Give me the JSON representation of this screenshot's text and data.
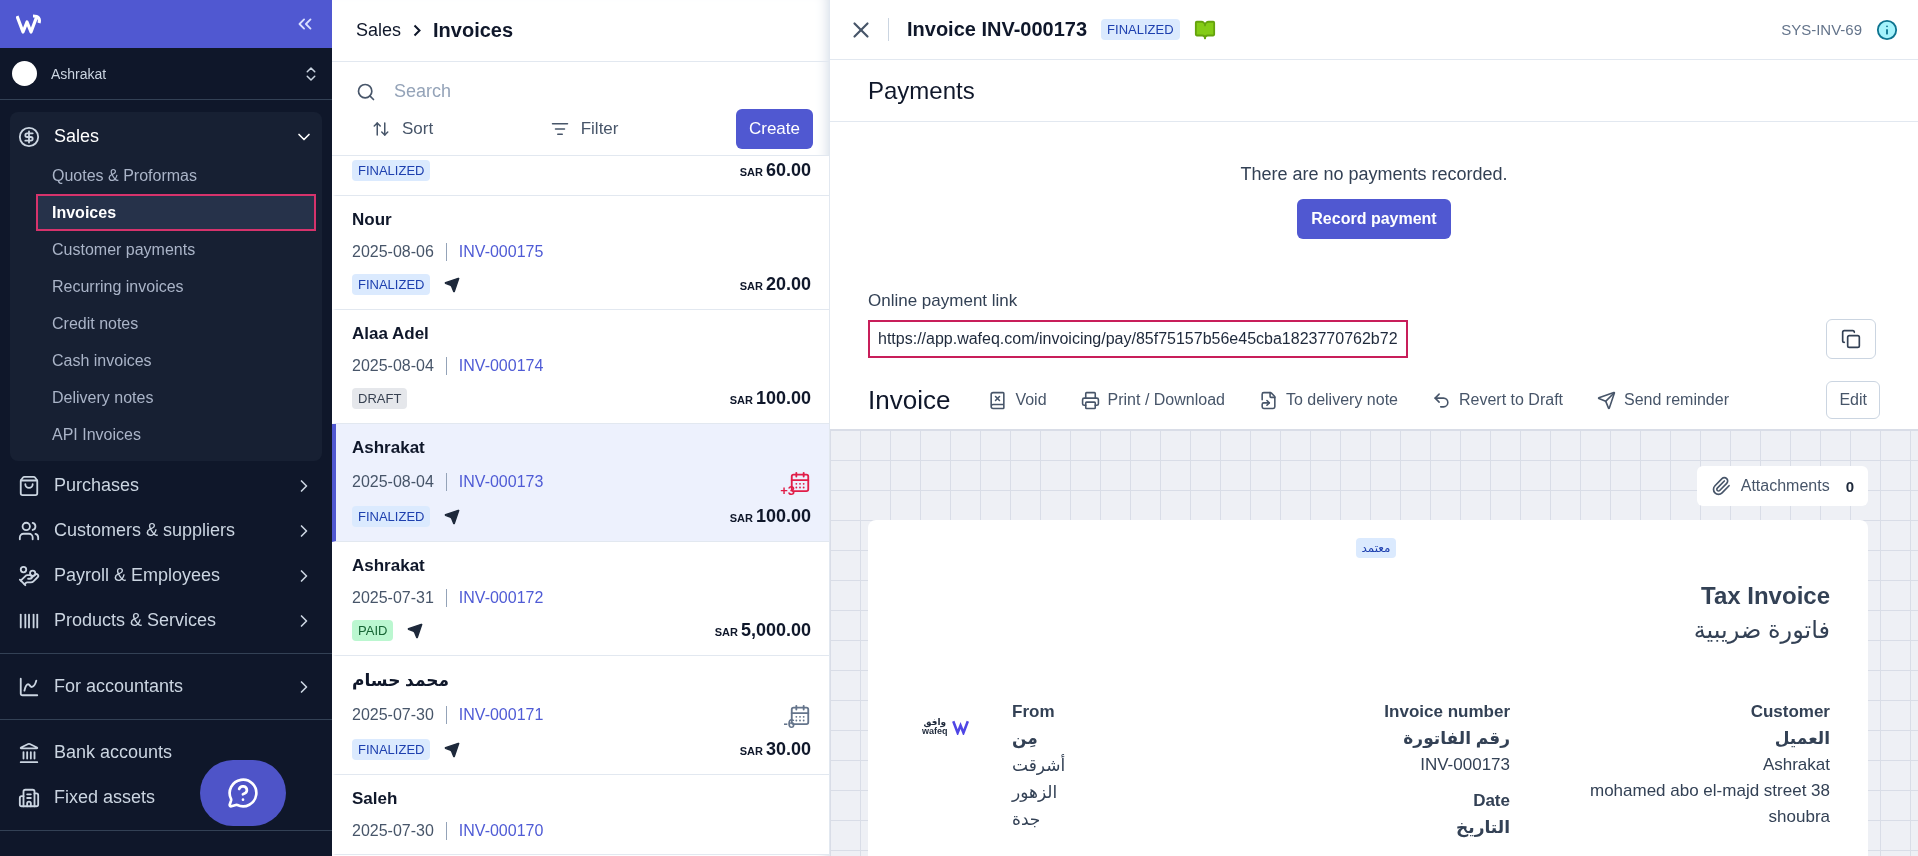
{
  "sidebar": {
    "org": "Ashrakat",
    "sections": [
      [
        {
          "label": "Sales",
          "expanded": true,
          "children": [
            {
              "label": "Quotes & Proformas",
              "selected": false
            },
            {
              "label": "Invoices",
              "selected": true
            },
            {
              "label": "Customer payments",
              "selected": false
            },
            {
              "label": "Recurring invoices",
              "selected": false
            },
            {
              "label": "Credit notes",
              "selected": false
            },
            {
              "label": "Cash invoices",
              "selected": false
            },
            {
              "label": "Delivery notes",
              "selected": false
            },
            {
              "label": "API Invoices",
              "selected": false
            }
          ]
        },
        {
          "label": "Purchases",
          "expanded": false
        },
        {
          "label": "Customers & suppliers",
          "expanded": false
        },
        {
          "label": "Payroll & Employees",
          "expanded": false
        },
        {
          "label": "Products & Services",
          "expanded": false
        }
      ],
      [
        {
          "label": "For accountants",
          "expanded": false
        }
      ],
      [
        {
          "label": "Bank accounts"
        },
        {
          "label": "Fixed assets"
        }
      ]
    ]
  },
  "list": {
    "breadcrumb": [
      "Sales",
      "Invoices"
    ],
    "search": {
      "placeholder": "Search"
    },
    "sort": "Sort",
    "filter": "Filter",
    "create": "Create",
    "rows": [
      {
        "status": "FINALIZED",
        "kind": "finalized",
        "sent": false,
        "currency": "SAR",
        "amount": "60.00",
        "selected": false
      },
      {
        "name": "Nour",
        "date": "2025-08-06",
        "number": "INV-000175",
        "status": "FINALIZED",
        "kind": "finalized",
        "sent": true,
        "currency": "SAR",
        "amount": "20.00",
        "selected": false
      },
      {
        "name": "Alaa Adel",
        "date": "2025-08-04",
        "number": "INV-000174",
        "status": "DRAFT",
        "kind": "draft",
        "sent": false,
        "currency": "SAR",
        "amount": "100.00",
        "selected": false
      },
      {
        "name": "Ashrakat",
        "date": "2025-08-04",
        "number": "INV-000173",
        "status": "FINALIZED",
        "kind": "finalized",
        "sent": true,
        "due": {
          "text": "+3",
          "color": "#e11d48"
        },
        "currency": "SAR",
        "amount": "100.00",
        "selected": true
      },
      {
        "name": "Ashrakat",
        "date": "2025-07-31",
        "number": "INV-000172",
        "status": "PAID",
        "kind": "paid",
        "sent": true,
        "currency": "SAR",
        "amount": "5,000.00",
        "selected": false
      },
      {
        "name": "محمد حسام",
        "date": "2025-07-30",
        "number": "INV-000171",
        "status": "FINALIZED",
        "kind": "finalized",
        "sent": true,
        "due": {
          "text": "-6",
          "color": "#64748b"
        },
        "currency": "SAR",
        "amount": "30.00",
        "selected": false
      },
      {
        "name": "Saleh",
        "date": "2025-07-30",
        "number": "INV-000170",
        "selected": false
      }
    ]
  },
  "detail": {
    "title": "Invoice INV-000173",
    "status": "FINALIZED",
    "reference": "SYS-INV-69",
    "payments": {
      "heading": "Payments",
      "empty": "There are no payments recorded.",
      "button": "Record payment",
      "link_label": "Online payment link",
      "link": "https://app.wafeq.com/invoicing/pay/85f75157b56e45cba1823770762b72"
    },
    "invoice": {
      "heading": "Invoice",
      "actions": [
        "Void",
        "Print / Download",
        "To delivery note",
        "Revert to Draft",
        "Send reminder"
      ],
      "edit": "Edit"
    },
    "attachments": {
      "label": "Attachments",
      "count": "0"
    },
    "document": {
      "stamp": "معتمد",
      "title": "Tax Invoice",
      "title_ar": "فاتورة ضريبية",
      "logo": [
        "وافق",
        "wafeq"
      ],
      "from": {
        "label": "From",
        "label_ar": "مِن",
        "lines": [
          "أشرقت",
          "الزهور",
          "جدة"
        ]
      },
      "number": {
        "label": "Invoice number",
        "label_ar": "رقم الفاتورة",
        "value": "INV-000173"
      },
      "date": {
        "label": "Date",
        "label_ar": "التاريخ"
      },
      "customer": {
        "label": "Customer",
        "label_ar": "العميل",
        "lines": [
          "Ashrakat",
          "mohamed abo el-majd street 38",
          "shoubra"
        ]
      }
    }
  }
}
